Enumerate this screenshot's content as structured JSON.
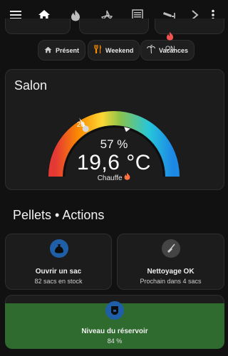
{
  "topbar": {
    "icons": [
      "menu-icon",
      "home-icon",
      "fire-icon",
      "fan-icon",
      "garage-icon",
      "cctv-icon",
      "chevron-right-icon",
      "more-vert-icon"
    ]
  },
  "modes": [
    {
      "label": "Présent",
      "icon": "home-icon"
    },
    {
      "label": "Weekend",
      "icon": "cutlery-icon"
    },
    {
      "label": "Vacances",
      "icon": "palm-tree-icon"
    }
  ],
  "salon": {
    "title": "Salon",
    "heat_state": "ON",
    "setpoint": "20",
    "humidity": "57 %",
    "temperature": "19,6 °C",
    "status": "Chauffe"
  },
  "gauge": {
    "min": 5,
    "max": 30,
    "current": 19.6,
    "target": 20,
    "colors": [
      "#e53935",
      "#fb8c00",
      "#fdd835",
      "#8bc34a",
      "#26c6da",
      "#1e88e5"
    ]
  },
  "section": {
    "title": "Pellets • Actions"
  },
  "actions": [
    {
      "title": "Ouvrir un sac",
      "subtitle": "82 sacs en stock",
      "icon": "bag-icon",
      "color": "#1e5fa8"
    },
    {
      "title": "Nettoyage OK",
      "subtitle": "Prochain dans 4 sacs",
      "icon": "broom-icon",
      "color": "#444444"
    }
  ],
  "reservoir": {
    "title": "Niveau du réservoir",
    "value": "84 %",
    "icon": "silo-icon",
    "color": "#2f6a2f"
  }
}
